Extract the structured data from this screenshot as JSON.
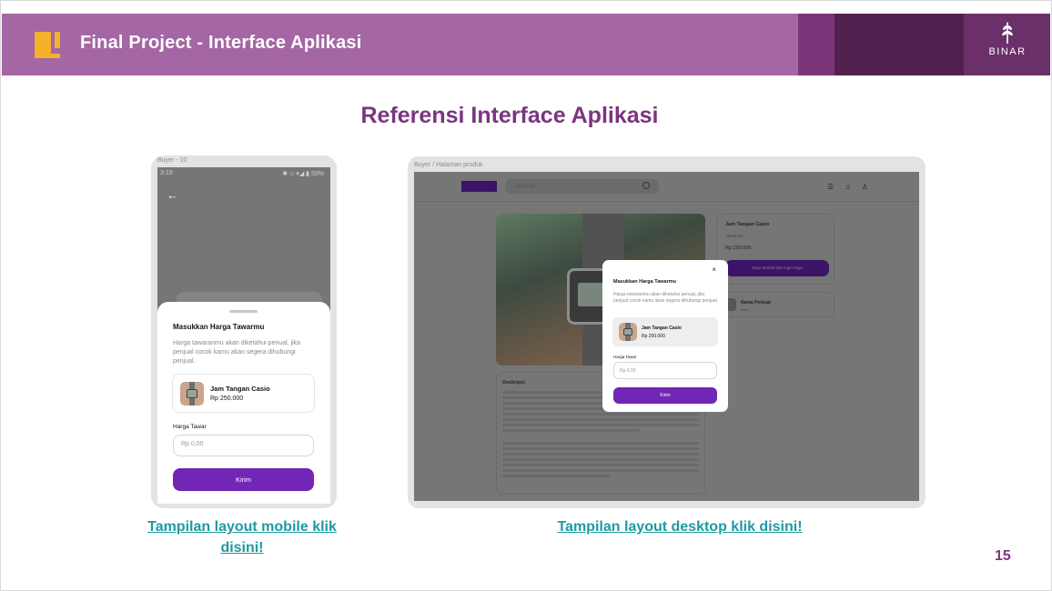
{
  "header": {
    "title": "Final Project - Interface Aplikasi",
    "logo_text": "BINAR",
    "colors": {
      "bar": "#a466a4",
      "dark": "#52204f",
      "accent_icon": "#f6b12b"
    }
  },
  "main": {
    "title": "Referensi Interface Aplikasi"
  },
  "mobile": {
    "frame_label": "Buyer - 10",
    "status_time": "3:19",
    "status_icons": "✱ ◇ ▾◢ ▮ 59%",
    "sheet": {
      "title": "Masukkan Harga Tawarmu",
      "description": "Harga tawaranmu akan diketahui penual, jika penjual cocok kamu akan segera dihubungi penjual.",
      "product_name": "Jam Tangan Casio",
      "product_price": "Rp 250.000",
      "input_label": "Harga Tawar",
      "input_placeholder": "Rp 0,00",
      "submit_label": "Kirim"
    }
  },
  "desktop": {
    "frame_label": "Buyer / Halaman produk",
    "search_placeholder": "Cari di sini ...",
    "nav_icons": "☰ ♫ ♙",
    "product": {
      "name": "Jam Tangan Casio",
      "category": "Aksesoris",
      "price": "Rp 250.000",
      "cta": "Saya tertarik dan ingin nego"
    },
    "seller": {
      "name": "Nama Penjual",
      "city": "Kota"
    },
    "description_title": "Deskripsi",
    "modal": {
      "close": "×",
      "title": "Masukkan Harga Tawarmu",
      "description": "Harga tawaranmu akan diketahui penual, jika penjual cocok kamu akan segera dihubungi penjual.",
      "product_name": "Jam Tangan Casio",
      "product_price": "Rp 250.000",
      "input_label": "Harga Tawar",
      "input_placeholder": "Rp 0,00",
      "submit_label": "Kirim"
    }
  },
  "links": {
    "mobile": "Tampilan layout mobile klik disini!",
    "desktop": "Tampilan layout desktop klik disini!"
  },
  "page_number": "15",
  "accent_purple": "#7126b5",
  "link_color": "#1d9aa0"
}
